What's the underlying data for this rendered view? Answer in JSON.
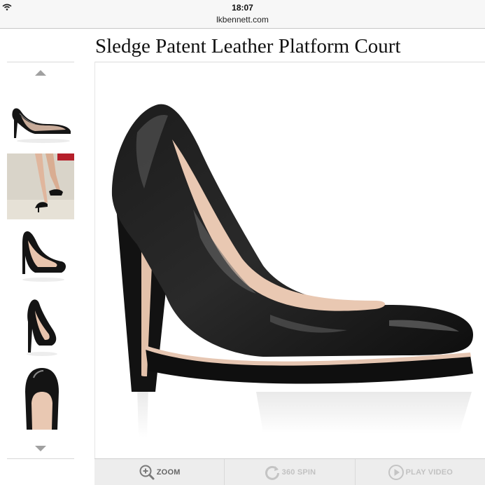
{
  "status_bar": {
    "time": "18:07",
    "url": "lkbennett.com"
  },
  "product": {
    "title": "Sledge Patent Leather Platform Court"
  },
  "colors": {
    "shoe": "#141414",
    "lining": "#e9c9b4",
    "toolbar": "#ededed"
  },
  "thumbnails": [
    {
      "view": "side-view"
    },
    {
      "view": "model-view"
    },
    {
      "view": "angled-view"
    },
    {
      "view": "rear-view"
    },
    {
      "view": "top-view"
    }
  ],
  "toolbar": {
    "zoom_label": "ZOOM",
    "spin_label": "360 SPIN",
    "video_label": "PLAY VIDEO"
  }
}
